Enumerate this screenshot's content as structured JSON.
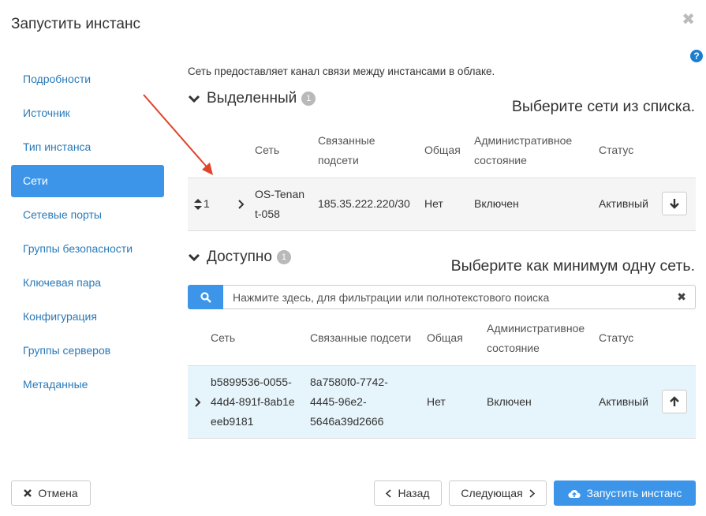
{
  "modal": {
    "title": "Запустить инстанс",
    "close": "✖",
    "help": "?"
  },
  "sidebar": {
    "items": [
      {
        "label": "Подробности"
      },
      {
        "label": "Источник"
      },
      {
        "label": "Тип инстанса"
      },
      {
        "label": "Сети"
      },
      {
        "label": "Сетевые порты"
      },
      {
        "label": "Группы безопасности"
      },
      {
        "label": "Ключевая пара"
      },
      {
        "label": "Конфигурация"
      },
      {
        "label": "Группы серверов"
      },
      {
        "label": "Метаданные"
      }
    ],
    "active_index": 3
  },
  "intro": "Сеть предоставляет канал связи между инстансами в облаке.",
  "allocated": {
    "title": "Выделенный",
    "count": "1",
    "hint": "Выберите сети из списка.",
    "headers": {
      "network": "Сеть",
      "subnets_1": "Связанные",
      "subnets_2": "подсети",
      "shared": "Общая",
      "admin_1": "Административное",
      "admin_2": "состояние",
      "status": "Статус"
    },
    "row": {
      "order": "1",
      "network_1": "OS-Tenan",
      "network_2": "t-058",
      "subnets": "185.35.222.220/30",
      "shared": "Нет",
      "admin": "Включен",
      "status": "Активный"
    }
  },
  "available": {
    "title": "Доступно",
    "count": "1",
    "hint": "Выберите как минимум одну сеть.",
    "search_placeholder": "Нажмите здесь, для фильтрации или полнотекстового поиска",
    "search_clear": "✖",
    "headers": {
      "network": "Сеть",
      "subnets": "Связанные подсети",
      "shared": "Общая",
      "admin_1": "Административное",
      "admin_2": "состояние",
      "status": "Статус"
    },
    "row": {
      "network_1": "b5899536-0055-",
      "network_2": "44d4-891f-8ab1e",
      "network_3": "eeb9181",
      "subnets_1": "8a7580f0-7742-",
      "subnets_2": "4445-96e2-",
      "subnets_3": "5646a39d2666",
      "shared": "Нет",
      "admin": "Включен",
      "status": "Активный"
    }
  },
  "footer": {
    "cancel": "Отмена",
    "back": "Назад",
    "next": "Следующая",
    "launch": "Запустить инстанс"
  },
  "colors": {
    "accent": "#3c95e8",
    "link": "#2a7ab8",
    "arrow": "#e0452b"
  }
}
